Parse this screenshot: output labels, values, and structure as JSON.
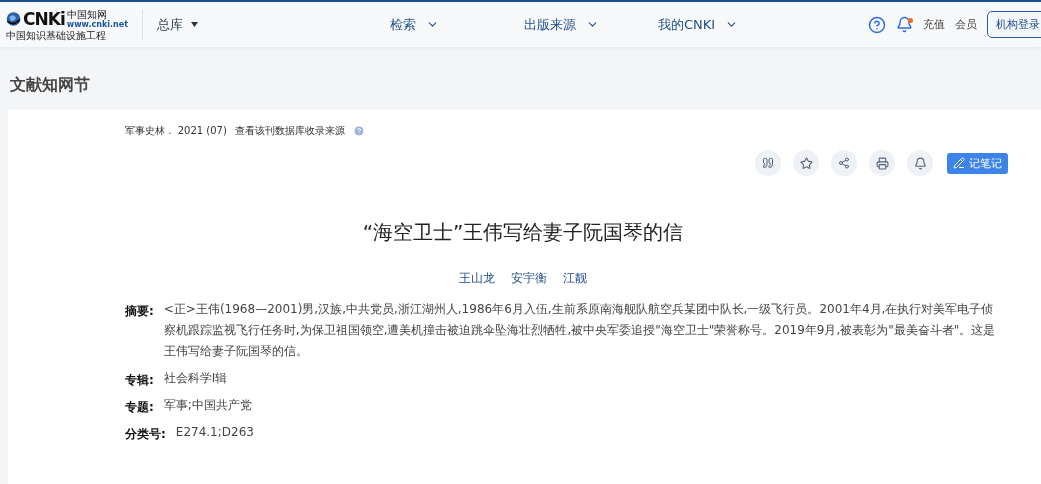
{
  "header": {
    "logo": {
      "mark": "CNKi",
      "cn": "中国知网",
      "url": "www.cnki.net",
      "slogan": "中国知识基础设施工程"
    },
    "library": "总库",
    "nav": [
      {
        "label": "检索"
      },
      {
        "label": "出版来源"
      },
      {
        "label": "我的CNKI"
      }
    ],
    "notifications": {
      "unread": true
    },
    "links": [
      "充值",
      "会员"
    ],
    "login": "机构登录"
  },
  "section_title": "文献知网节",
  "article": {
    "source": "军事史林 .  2021 (07)",
    "source_link": "查看该刊数据库收录来源",
    "actions": [
      {
        "kind": "quote"
      },
      {
        "kind": "star"
      },
      {
        "kind": "share"
      },
      {
        "kind": "print"
      },
      {
        "kind": "bell"
      }
    ],
    "note_button": "记笔记",
    "title": "“海空卫士”王伟写给妻子阮国琴的信",
    "authors": [
      "王山龙",
      "安宇衡",
      "江靓"
    ],
    "fields": [
      {
        "label": "摘要:",
        "value": "<正>王伟(1968—2001)男,汉族,中共党员,浙江湖州人,1986年6月入伍,生前系原南海舰队航空兵某团中队长,一级飞行员。2001年4月,在执行对美军电子侦察机跟踪监视飞行任务时,为保卫祖国领空,遭美机撞击被迫跳伞坠海壮烈牺牲,被中央军委追授\"海空卫士\"荣誉称号。2019年9月,被表彰为\"最美奋斗者\"。这是王伟写给妻子阮国琴的信。"
      },
      {
        "label": "专辑:",
        "value": "社会科学Ⅰ辑"
      },
      {
        "label": "专题:",
        "value": "军事;中国共产党"
      },
      {
        "label": "分类号:",
        "value": "E274.1;D263"
      }
    ]
  }
}
